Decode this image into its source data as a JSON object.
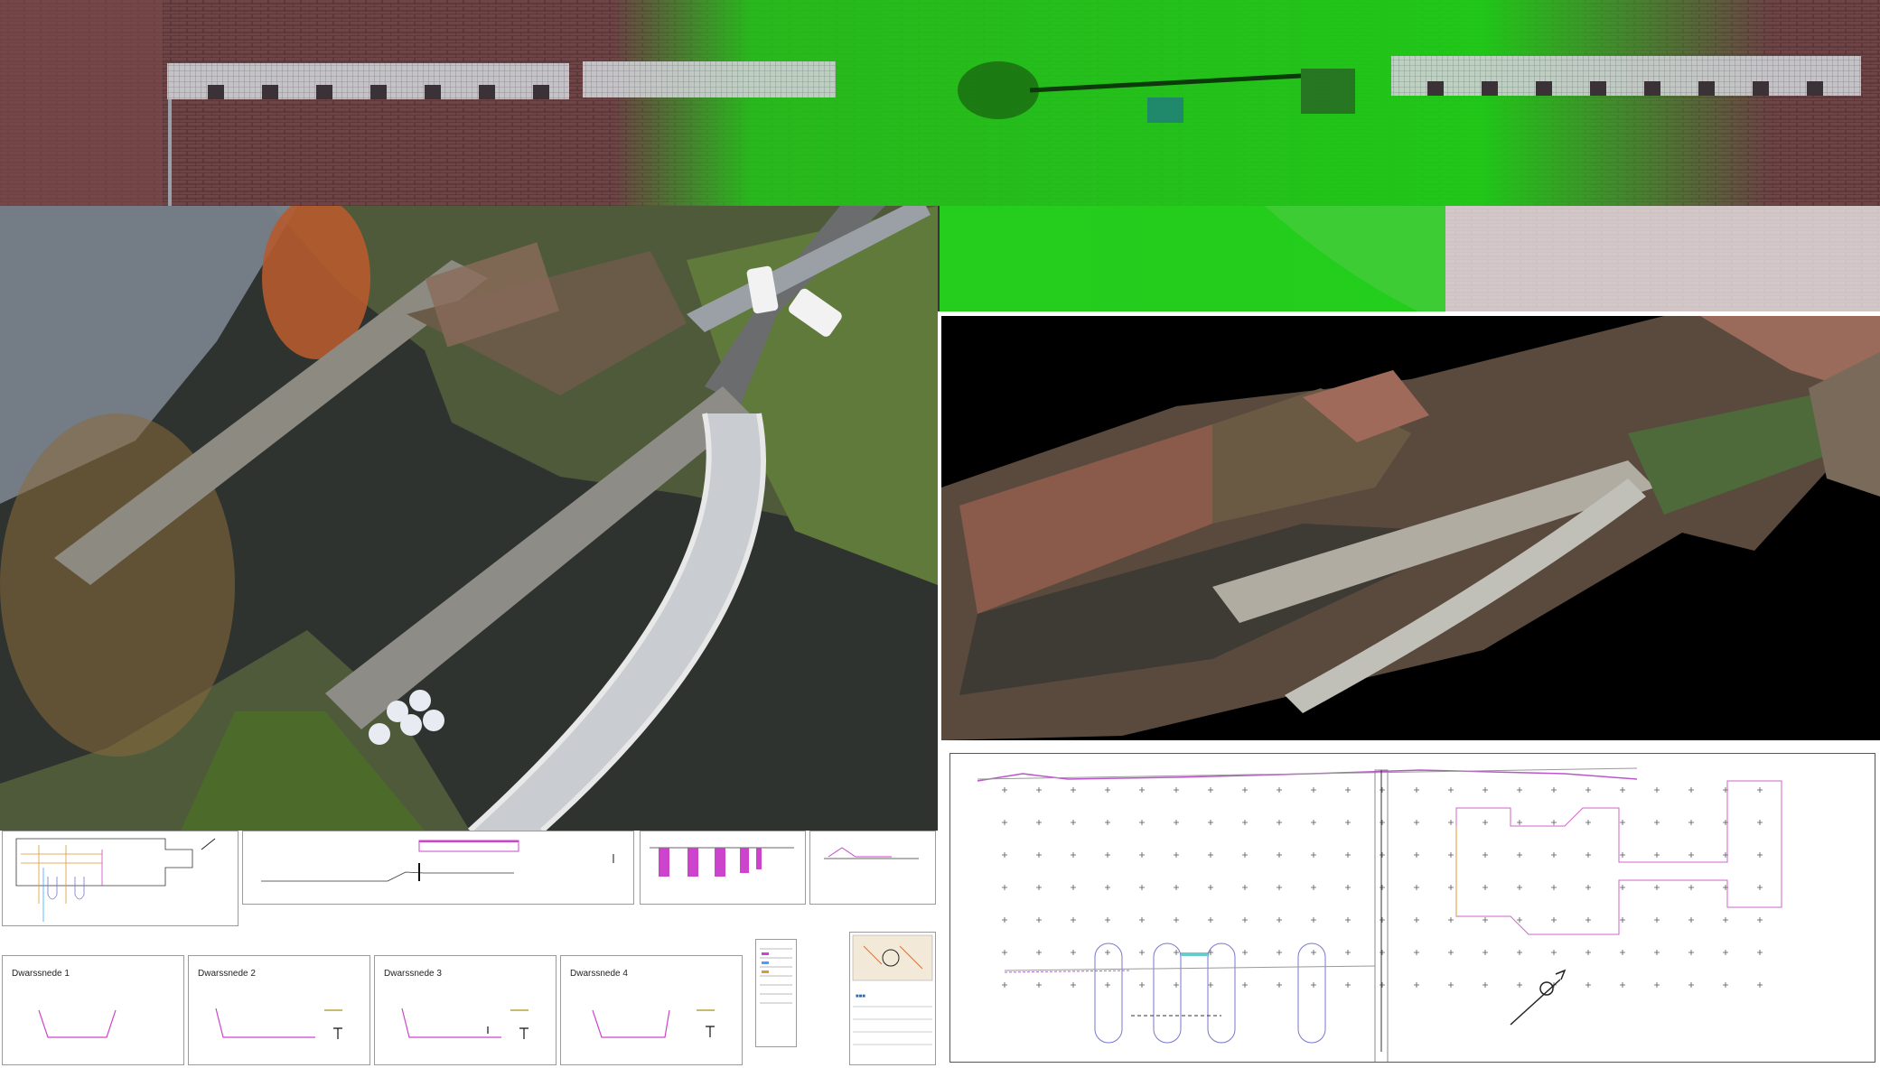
{
  "sections": {
    "top": {
      "name": "wall-orthophoto-with-deviation-overlay"
    },
    "drone": {
      "name": "aerial-drone-photo-weir-and-bridge"
    },
    "cloud": {
      "name": "point-cloud-rendering"
    },
    "plan": {
      "name": "survey-plan-drawing"
    },
    "sheet": {
      "name": "cross-section-drawing-sheet"
    }
  },
  "cross_sections": [
    {
      "label": "Dwarssnede 1",
      "profile": "u"
    },
    {
      "label": "Dwarssnede 2",
      "profile": "step"
    },
    {
      "label": "Dwarssnede 3",
      "profile": "step"
    },
    {
      "label": "Dwarssnede 4",
      "profile": "u"
    }
  ],
  "colors": {
    "deviation_green": "#19d414",
    "brick": "#7a4a4a",
    "water": "#2f3330",
    "magenta": "#d23ad2",
    "grass": "#6e8a3a"
  }
}
